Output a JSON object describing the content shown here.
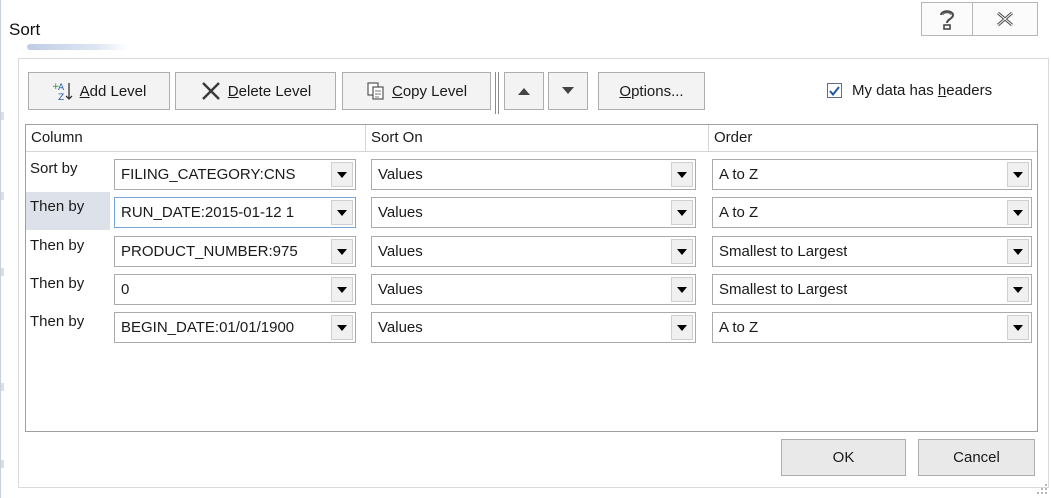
{
  "dialog": {
    "title": "Sort",
    "help_icon": "help-icon",
    "close_icon": "close-icon"
  },
  "toolbar": {
    "add_level_prefix": "",
    "add_level_hotkey": "A",
    "add_level_rest": "dd Level",
    "delete_level_hotkey": "D",
    "delete_level_rest": "elete Level",
    "copy_level_hotkey": "C",
    "copy_level_rest": "opy Level",
    "options_hotkey": "O",
    "options_rest": "ptions...",
    "headers_prefix": "My data has ",
    "headers_hotkey": "h",
    "headers_rest": "eaders",
    "headers_checked": true
  },
  "columns": {
    "column": "Column",
    "sort_on": "Sort On",
    "order": "Order"
  },
  "rows": [
    {
      "label": "Sort by",
      "column": "FILING_CATEGORY:CNS",
      "sort_on": "Values",
      "order": "A to Z"
    },
    {
      "label": "Then by",
      "column": "RUN_DATE:2015-01-12 1",
      "sort_on": "Values",
      "order": "A to Z"
    },
    {
      "label": "Then by",
      "column": "PRODUCT_NUMBER:975",
      "sort_on": "Values",
      "order": "Smallest to Largest"
    },
    {
      "label": "Then by",
      "column": "0",
      "sort_on": "Values",
      "order": "Smallest to Largest"
    },
    {
      "label": "Then by",
      "column": "BEGIN_DATE:01/01/1900",
      "sort_on": "Values",
      "order": "A to Z"
    }
  ],
  "footer": {
    "ok": "OK",
    "cancel": "Cancel"
  },
  "colors": {
    "selected_row": "#dde2ea",
    "check": "#1f5aa8"
  }
}
